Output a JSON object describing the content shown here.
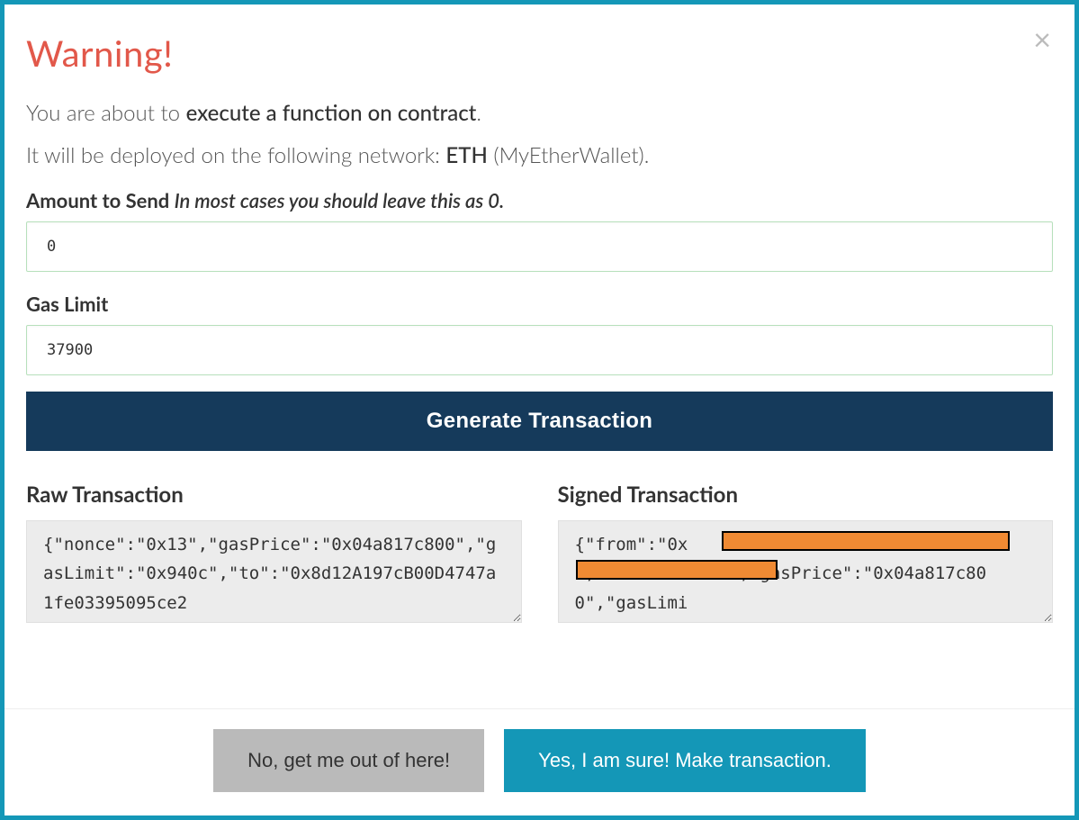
{
  "title": "Warning!",
  "intro": {
    "line1_prefix": "You are about to ",
    "line1_bold": "execute a function on contract",
    "line1_suffix": ".",
    "line2_prefix": "It will be deployed on the following network: ",
    "network_name": "ETH",
    "network_service": " (MyEtherWallet)."
  },
  "fields": {
    "amount": {
      "label": "Amount to Send ",
      "hint": "In most cases you should leave this as 0.",
      "value": "0"
    },
    "gas_limit": {
      "label": "Gas Limit",
      "value": "37900"
    }
  },
  "actions": {
    "generate": "Generate Transaction",
    "cancel": "No, get me out of here!",
    "confirm": "Yes, I am sure! Make transaction."
  },
  "transactions": {
    "raw": {
      "label": "Raw Transaction",
      "value": "{\"nonce\":\"0x13\",\"gasPrice\":\"0x04a817c800\",\"gasLimit\":\"0x940c\",\"to\":\"0x8d12A197cB00D4747a1fe03395095ce2"
    },
    "signed": {
      "label": "Signed Transaction",
      "value_prefix": "{\"from\":\"0x",
      "value_suffix": "\",\"nonce\":\"0x13\",\"gasPrice\":\"0x04a817c800\",\"gasLimi"
    }
  },
  "icons": {
    "close": "×"
  }
}
